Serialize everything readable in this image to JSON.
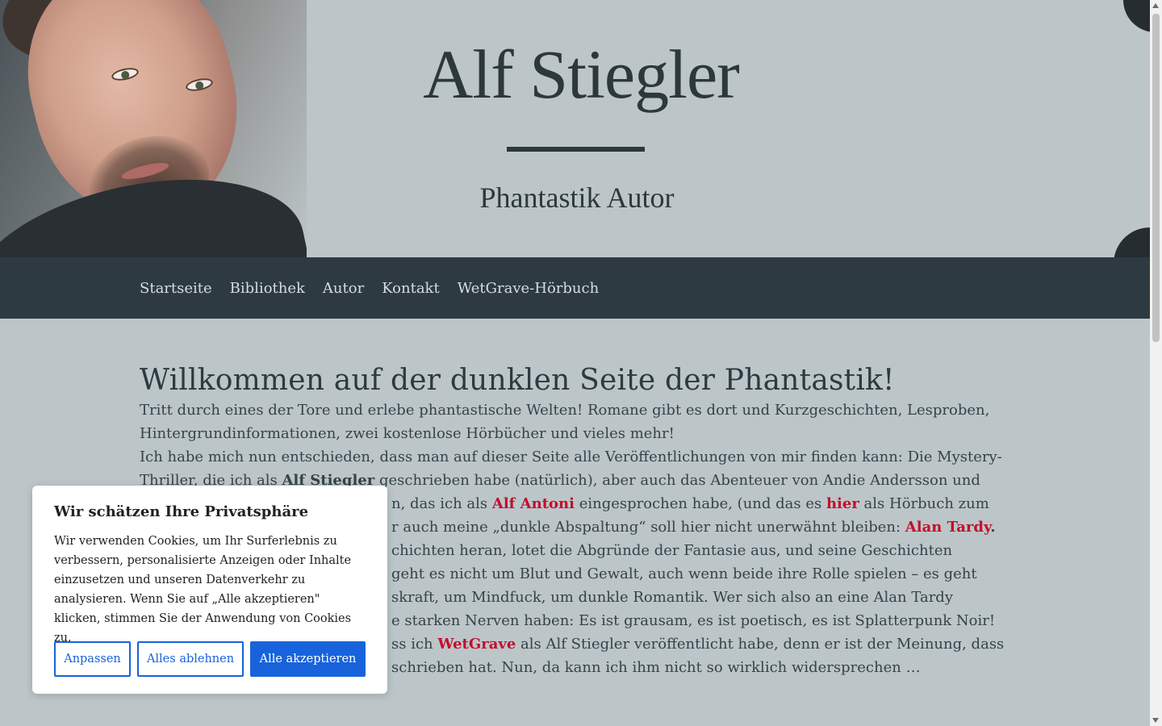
{
  "header": {
    "title": "Alf Stiegler",
    "subtitle": "Phantastik Autor"
  },
  "nav": {
    "items": [
      "Startseite",
      "Bibliothek",
      "Autor",
      "Kontakt",
      "WetGrave-Hörbuch"
    ]
  },
  "main": {
    "heading": "Willkommen auf der dunklen Seite der Phantastik!",
    "p1": "Tritt durch eines der Tore und erlebe phantastische Welten! Romane gibt es dort und Kurzgeschichten, Lesproben, Hintergrundinformationen, zwei kostenlose Hörbücher und vieles mehr!",
    "p2_a": "Ich habe mich nun entschieden, dass man auf dieser Seite alle Veröffentlichungen von mir finden kann: Die Mystery-Thriller, die ich als ",
    "p2_bold1": "Alf Stiegler",
    "p2_b": " geschrieben habe (natürlich), aber auch das Abenteuer von Andie Andersson und ",
    "p2_c": "n, das ich als ",
    "p2_link1": "Alf Antoni",
    "p2_d": " eingesprochen habe, (und das es ",
    "p2_link2": "hier",
    "p2_e": " als Hörbuch zum ",
    "p2_f": "r auch meine „dunkle Abspaltung“ soll hier nicht unerwähnt bleiben: ",
    "p2_link3": "Alan Tardy",
    "p2_g": ".",
    "p2_h": "chichten heran, lotet die Abgründe der Fantasie aus, und seine Geschichten",
    "p2_i": " geht es nicht um Blut und Gewalt, auch wenn beide ihre Rolle spielen – es geht",
    "p2_j": "skraft, um Mindfuck, um dunkle Romantik. Wer sich also an eine Alan Tardy",
    "p2_k": "e starken Nerven haben: Es ist grausam, es ist poetisch, es ist Splatterpunk Noir!",
    "p2_l": "ss ich ",
    "p2_link4": "WetGrave",
    "p2_m": " als Alf Stiegler veröffentlicht habe, denn er ist der Meinung, dass",
    "p2_n": "schrieben hat. Nun, da kann ich ihm nicht so wirklich widersprechen …"
  },
  "cookie": {
    "title": "Wir schätzen Ihre Privatsphäre",
    "text": "Wir verwenden Cookies, um Ihr Surferlebnis zu verbessern, personalisierte Anzeigen oder Inhalte einzusetzen und unseren Datenverkehr zu analysieren. Wenn Sie auf „Alle akzeptieren\" klicken, stimmen Sie der Anwendung von Cookies zu.",
    "customize_label": "Anpassen",
    "reject_label": "Alles ablehnen",
    "accept_label": "Alle akzeptieren"
  },
  "colors": {
    "background": "#bcc6c9",
    "nav_bg": "#2d3a41",
    "link": "#c1102d",
    "accept_button": "#1863dc"
  }
}
